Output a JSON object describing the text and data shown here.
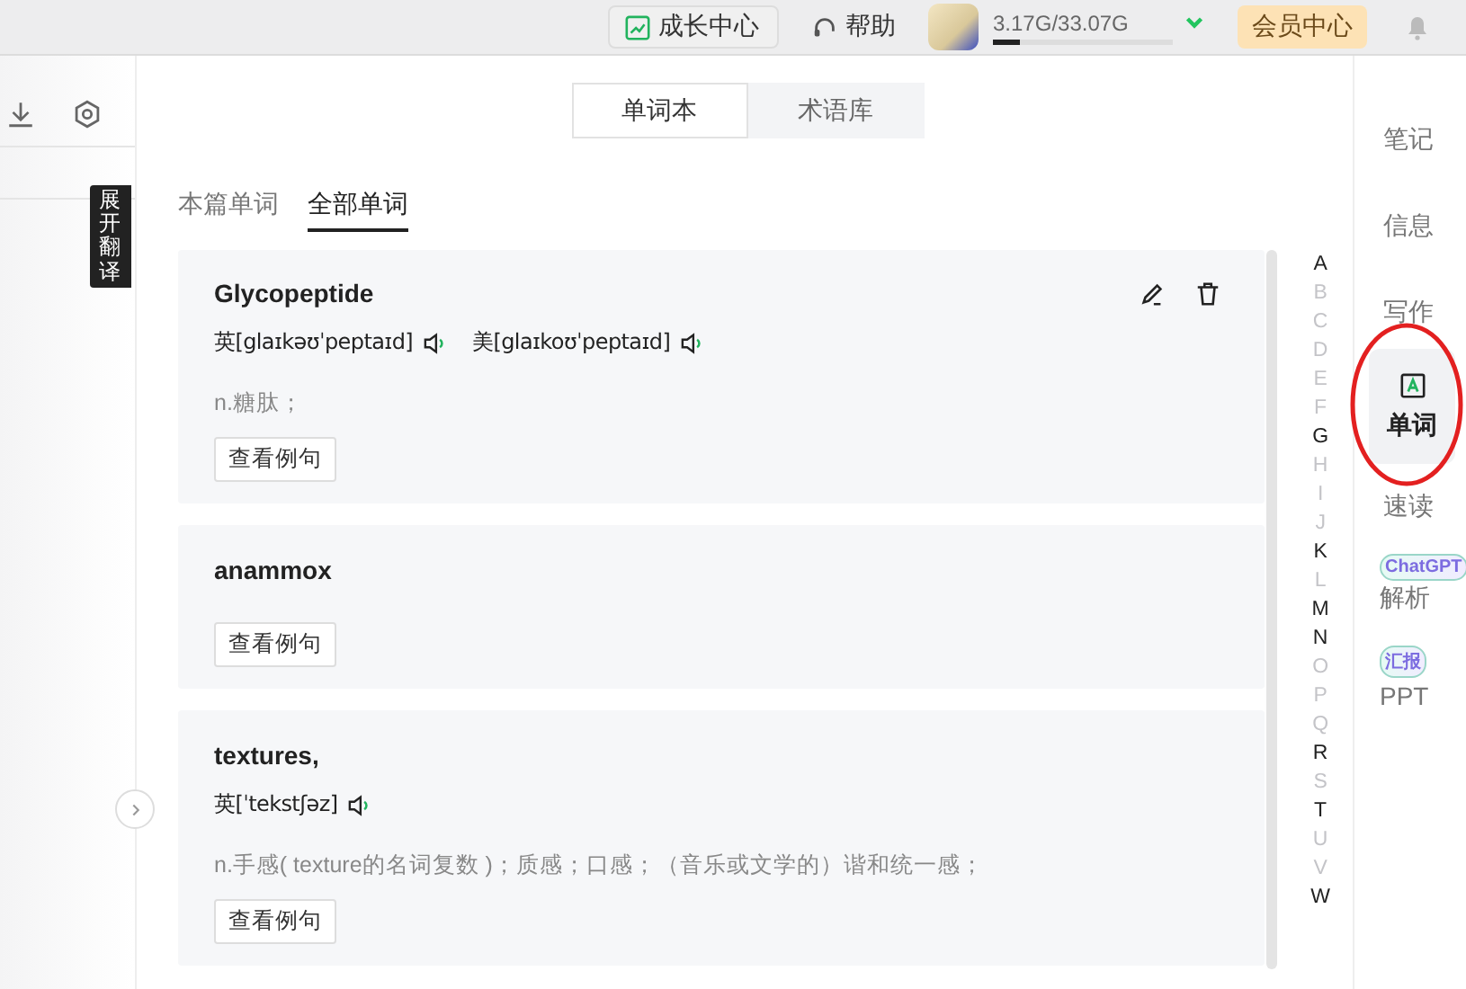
{
  "top_bar": {
    "growth_button": "成长中心",
    "help": "帮助",
    "storage": {
      "text": "3.17G/33.07G",
      "level": 0.15
    },
    "vip_button": "会员中心"
  },
  "left_panel": {
    "tooltip": "展开翻译"
  },
  "tabs": [
    {
      "label": "单词本",
      "selected": true
    },
    {
      "label": "术语库",
      "selected": false
    }
  ],
  "subtabs": [
    {
      "label": "本篇单词",
      "selected": false
    },
    {
      "label": "全部单词",
      "selected": true
    }
  ],
  "words": [
    {
      "word": "Glycopeptide",
      "hovered": true,
      "pronunciations": [
        "英[glaɪkəʊˈpeptaɪd]",
        "美[glaɪkoʊˈpeptaɪd]"
      ],
      "definition": "n.糖肽；",
      "button": "查看例句"
    },
    {
      "word": "anammox",
      "hovered": false,
      "button": "查看例句"
    },
    {
      "word": "textures,",
      "hovered": false,
      "pronunciations": [
        "英[ˈtekstʃəz]"
      ],
      "definition": "n.手感( texture的名词复数 )；质感；口感；（音乐或文学的）谐和统一感；",
      "button": "查看例句"
    }
  ],
  "letters": [
    {
      "letter": "A",
      "available": true
    },
    {
      "letter": "B",
      "available": false
    },
    {
      "letter": "C",
      "available": false
    },
    {
      "letter": "D",
      "available": false
    },
    {
      "letter": "E",
      "available": false
    },
    {
      "letter": "F",
      "available": false
    },
    {
      "letter": "G",
      "available": true
    },
    {
      "letter": "H",
      "available": false
    },
    {
      "letter": "I",
      "available": false
    },
    {
      "letter": "J",
      "available": false
    },
    {
      "letter": "K",
      "available": true
    },
    {
      "letter": "L",
      "available": false
    },
    {
      "letter": "M",
      "available": true
    },
    {
      "letter": "N",
      "available": true
    },
    {
      "letter": "O",
      "available": false
    },
    {
      "letter": "P",
      "available": false
    },
    {
      "letter": "Q",
      "available": false
    },
    {
      "letter": "R",
      "available": true
    },
    {
      "letter": "S",
      "available": false
    },
    {
      "letter": "T",
      "available": true
    },
    {
      "letter": "U",
      "available": false
    },
    {
      "letter": "V",
      "available": false
    },
    {
      "letter": "W",
      "available": true
    }
  ],
  "sidebar": [
    {
      "kind": "text",
      "label": "笔记",
      "selected": false
    },
    {
      "kind": "text",
      "label": "信息",
      "selected": false
    },
    {
      "kind": "text",
      "label": "写作",
      "selected": false
    },
    {
      "kind": "icon",
      "label": "单词",
      "selected": true
    },
    {
      "kind": "text",
      "label": "速读",
      "selected": false
    },
    {
      "kind": "badge",
      "badge": "ChatGPT",
      "label": "解析",
      "selected": false
    },
    {
      "kind": "badge",
      "badge": "汇报",
      "label": "PPT",
      "selected": false
    }
  ]
}
